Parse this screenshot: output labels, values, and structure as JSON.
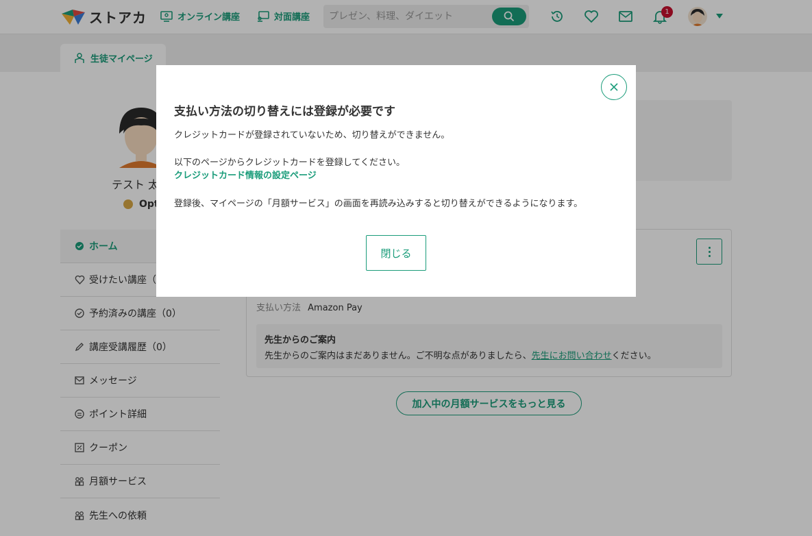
{
  "header": {
    "logo_text": "ストアカ",
    "nav_online": "オンライン講座",
    "nav_inperson": "対面講座",
    "search_placeholder": "プレゼン、料理、ダイエット",
    "notification_count": "1",
    "icons": [
      "history-icon",
      "heart-icon",
      "mail-icon",
      "bell-icon",
      "search-icon"
    ],
    "brand_color": "#1a9c7a"
  },
  "tabs": {
    "mypage_label": "生徒マイページ"
  },
  "profile": {
    "name": "テスト 太",
    "points": "Opt"
  },
  "side_menu": {
    "items": [
      {
        "label": "ホーム"
      },
      {
        "label": "受けたい講座（"
      },
      {
        "label": "予約済みの講座（0）"
      },
      {
        "label": "講座受講履歴（0）"
      },
      {
        "label": "メッセージ"
      },
      {
        "label": "ポイント詳細"
      },
      {
        "label": "クーポン"
      },
      {
        "label": "月額サービス"
      },
      {
        "label": "先生への依頼"
      }
    ]
  },
  "subscription": {
    "payment_label": "支払い方法",
    "payment_value": "Amazon Pay",
    "notice_title": "先生からのご案内",
    "notice_text_before": "先生からのご案内はまだありません。ご不明な点がありましたら、",
    "notice_link": "先生にお問い合わせ",
    "notice_text_after": "ください。",
    "more_button": "加入中の月額サービスをもっと見る"
  },
  "modal": {
    "title": "支払い方法の切り替えには登録が必要です",
    "line1": "クレジットカードが登録されていないため、切り替えができません。",
    "line2": "以下のページからクレジットカードを登録してください。",
    "link": "クレジットカード情報の設定ページ",
    "line3": "登録後、マイページの「月額サービス」の画面を再読み込みすると切り替えができるようになります。",
    "close_button": "閉じる"
  }
}
